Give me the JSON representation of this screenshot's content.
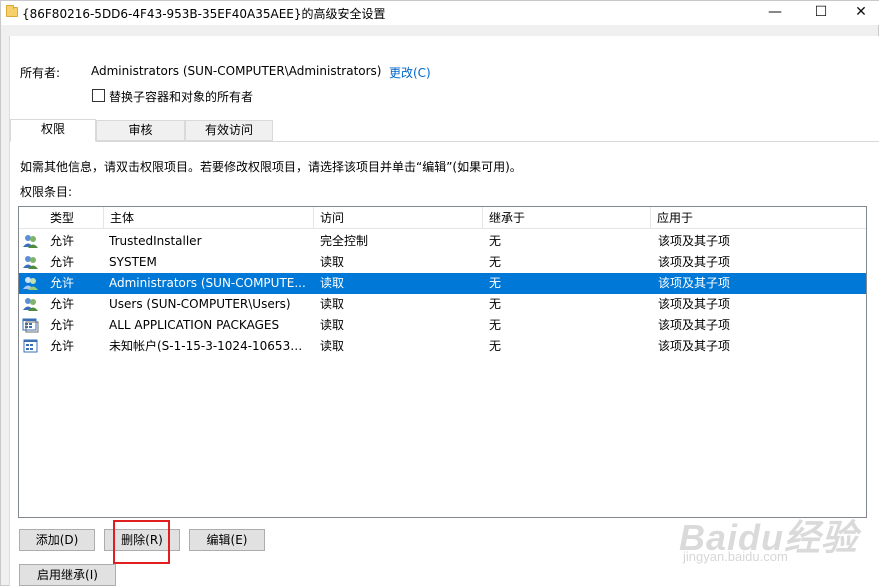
{
  "window": {
    "title": "{86F80216-5DD6-4F43-953B-35EF40A35AEE}的高级安全设置",
    "minimize_glyph": "—",
    "maximize_glyph": "☐",
    "close_glyph": "✕"
  },
  "owner": {
    "label": "所有者:",
    "value": "Administrators (SUN-COMPUTER\\Administrators)",
    "change_link": "更改(C)",
    "replace_checkbox_label": "替换子容器和对象的所有者",
    "replace_checked": false
  },
  "tabs": [
    {
      "label": "权限",
      "active": true
    },
    {
      "label": "审核",
      "active": false
    },
    {
      "label": "有效访问",
      "active": false
    }
  ],
  "info_text": "如需其他信息，请双击权限项目。若要修改权限项目，请选择该项目并单击“编辑”(如果可用)。",
  "entries_label": "权限条目:",
  "table": {
    "headers": [
      "类型",
      "主体",
      "访问",
      "继承于",
      "应用于"
    ],
    "rows": [
      {
        "icon": "users-icon",
        "type": "允许",
        "principal": "TrustedInstaller",
        "access": "完全控制",
        "inherited_from": "无",
        "applies_to": "该项及其子项",
        "selected": false
      },
      {
        "icon": "users-icon",
        "type": "允许",
        "principal": "SYSTEM",
        "access": "读取",
        "inherited_from": "无",
        "applies_to": "该项及其子项",
        "selected": false
      },
      {
        "icon": "users-icon",
        "type": "允许",
        "principal": "Administrators (SUN-COMPUTE...",
        "access": "读取",
        "inherited_from": "无",
        "applies_to": "该项及其子项",
        "selected": true
      },
      {
        "icon": "users-icon",
        "type": "允许",
        "principal": "Users (SUN-COMPUTER\\Users)",
        "access": "读取",
        "inherited_from": "无",
        "applies_to": "该项及其子项",
        "selected": false
      },
      {
        "icon": "app-packages-icon",
        "type": "允许",
        "principal": "ALL APPLICATION PACKAGES",
        "access": "读取",
        "inherited_from": "无",
        "applies_to": "该项及其子项",
        "selected": false
      },
      {
        "icon": "app-package-icon",
        "type": "允许",
        "principal": "未知帐户(S-1-15-3-1024-1065365...",
        "access": "读取",
        "inherited_from": "无",
        "applies_to": "该项及其子项",
        "selected": false
      }
    ]
  },
  "buttons": {
    "add": "添加(D)",
    "remove": "删除(R)",
    "edit": "编辑(E)",
    "enable_inheritance": "启用继承(I)"
  },
  "watermark": {
    "brand": "Baidu经验",
    "url": "jingyan.baidu.com"
  },
  "colors": {
    "selection": "#0078d7",
    "link": "#0066cc",
    "highlight_box": "#e02020"
  }
}
